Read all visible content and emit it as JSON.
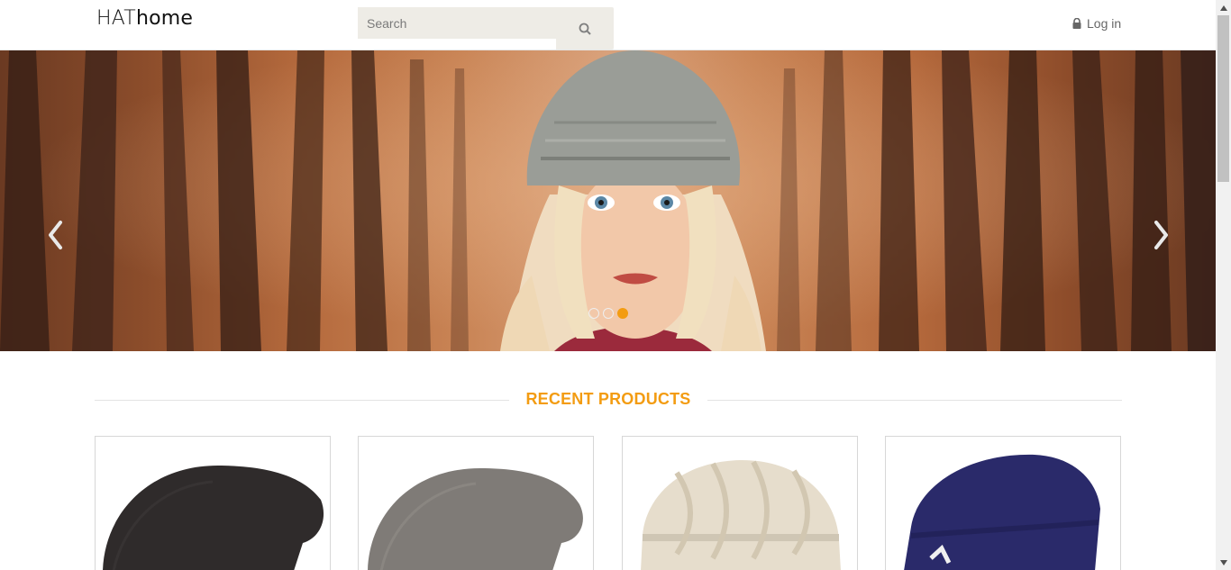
{
  "header": {
    "logo_part1": "HAT",
    "logo_part2": "home",
    "search_placeholder": "Search",
    "login_label": "Log in"
  },
  "hero": {
    "slide_count": 3,
    "active_slide": 3
  },
  "section": {
    "title": "RECENT PRODUCTS"
  },
  "products": [
    {
      "color": "#2f2b2b"
    },
    {
      "color": "#7f7b77"
    },
    {
      "color": "#e6ddcc"
    },
    {
      "color": "#2a2a6a"
    }
  ],
  "colors": {
    "accent": "#f39c12",
    "search_bg": "#eeece6"
  },
  "icons": {
    "search": "search-icon",
    "login": "lock-icon",
    "prev": "chevron-left-icon",
    "next": "chevron-right-icon"
  }
}
